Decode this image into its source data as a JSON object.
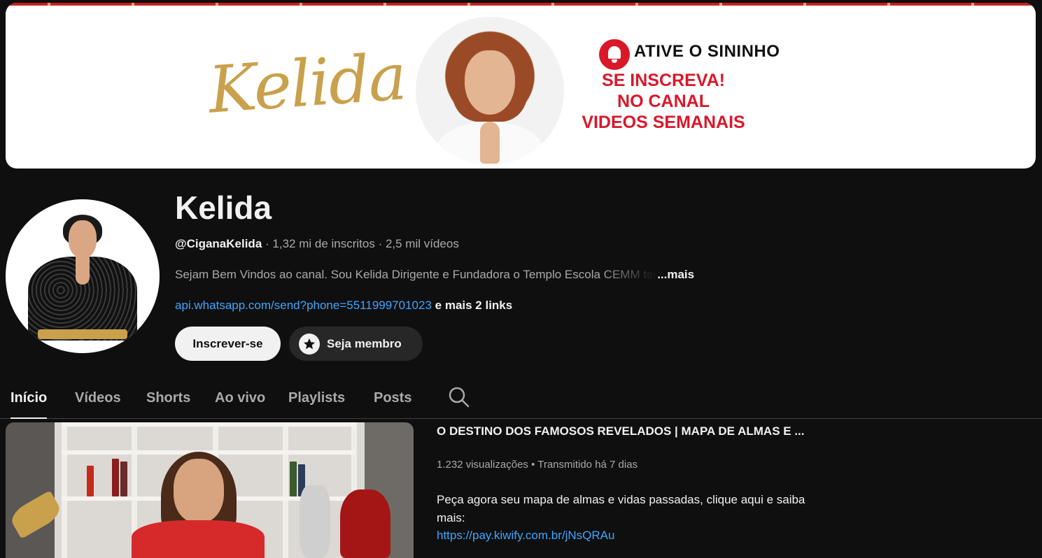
{
  "banner": {
    "script_logo": "Kelida",
    "cta_bell": "ATIVE O SININHO",
    "cta_lines": [
      "SE INSCREVA!",
      "NO CANAL",
      "VIDEOS SEMANAIS"
    ]
  },
  "channel": {
    "name": "Kelida",
    "handle": "@CiganaKelida",
    "subscribers": " · 1,32 mi de inscritos · 2,5 mil vídeos",
    "description": "Sejam Bem Vindos ao canal. Sou Kelida Dirigente e Fundadora o Templo Escola CEMM ter",
    "description_more": "...mais",
    "link": "api.whatsapp.com/send?phone=5511999701023",
    "more_links": " e mais 2 links",
    "subscribe_label": "Inscrever-se",
    "member_label": "Seja membro"
  },
  "tabs": [
    {
      "label": "Início",
      "active": true
    },
    {
      "label": "Vídeos",
      "active": false
    },
    {
      "label": "Shorts",
      "active": false
    },
    {
      "label": "Ao vivo",
      "active": false
    },
    {
      "label": "Playlists",
      "active": false
    },
    {
      "label": "Posts",
      "active": false
    }
  ],
  "featured": {
    "title": "O DESTINO DOS FAMOSOS REVELADOS | MAPA DE ALMAS E ...",
    "meta": "1.232 visualizações • Transmitido há 7 dias",
    "description": "Peça agora seu mapa de almas e vidas passadas, clique aqui e saiba mais:",
    "link": "https://pay.kiwify.com.br/jNsQRAu"
  },
  "colors": {
    "background": "#0f0f0f",
    "link": "#3ea6ff",
    "banner_red": "#d9182a",
    "banner_gold": "#c9a14c"
  }
}
